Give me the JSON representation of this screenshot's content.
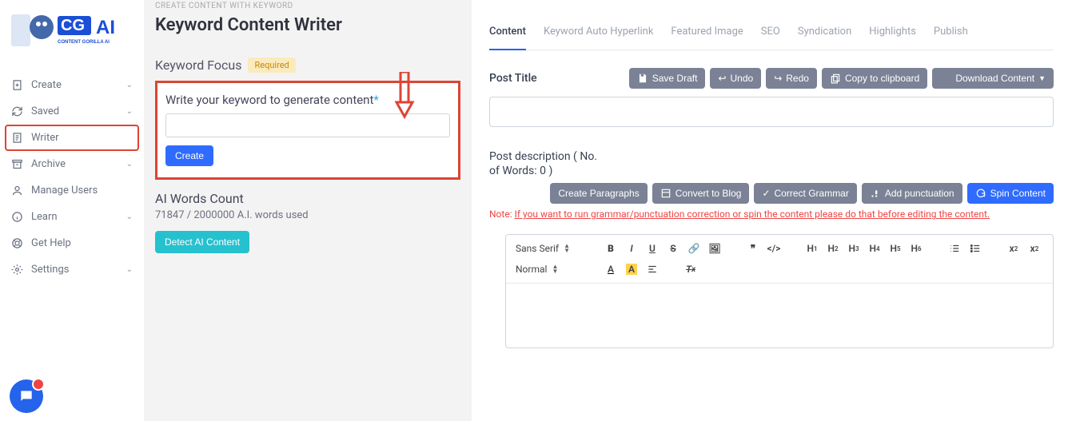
{
  "sidebar": {
    "items": [
      {
        "label": "Create",
        "icon": "plus-doc",
        "expand": true
      },
      {
        "label": "Saved",
        "icon": "refresh",
        "expand": true
      },
      {
        "label": "Writer",
        "icon": "doc",
        "active": true
      },
      {
        "label": "Archive",
        "icon": "archive",
        "expand": true
      },
      {
        "label": "Manage Users",
        "icon": "user"
      },
      {
        "label": "Learn",
        "icon": "info",
        "expand": true
      },
      {
        "label": "Get Help",
        "icon": "help"
      },
      {
        "label": "Settings",
        "icon": "gear",
        "expand": true
      }
    ]
  },
  "breadcrumb": "CREATE CONTENT WITH KEYWORD",
  "page_title": "Keyword Content Writer",
  "kf": {
    "heading": "Keyword Focus",
    "required_badge": "Required",
    "label": "Write your keyword to generate content",
    "value": "",
    "create": "Create"
  },
  "ai": {
    "heading": "AI Words Count",
    "line": "71847 / 2000000 A.I. words used",
    "detect": "Detect AI Content"
  },
  "tabs": [
    "Content",
    "Keyword Auto Hyperlink",
    "Featured Image",
    "SEO",
    "Syndication",
    "Highlights",
    "Publish"
  ],
  "post_title_label": "Post Title",
  "btns": {
    "save": "Save Draft",
    "undo": "Undo",
    "redo": "Redo",
    "copy": "Copy to clipboard",
    "download": "Download Content",
    "para": "Create Paragraphs",
    "blog": "Convert to Blog",
    "grammar": "Correct Grammar",
    "punct": "Add punctuation",
    "spin": "Spin Content"
  },
  "desc_label": "Post description ( No. of Words: 0 )",
  "note": {
    "label": "Note: ",
    "link": "If you want to run grammar/punctuation correction or spin the content please do that before editing the content."
  },
  "editor": {
    "font": "Sans Serif",
    "size": "Normal"
  }
}
